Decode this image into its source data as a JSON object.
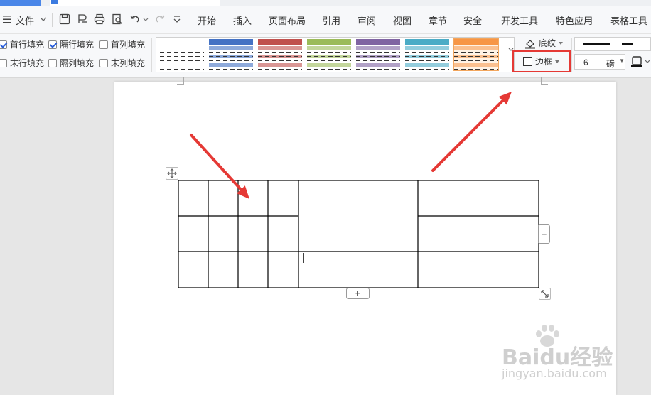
{
  "menubar": {
    "file": "文件",
    "tabs": [
      "开始",
      "插入",
      "页面布局",
      "引用",
      "审阅",
      "视图",
      "章节",
      "安全",
      "开发工具",
      "特色应用",
      "表格工具"
    ]
  },
  "ribbon": {
    "options": [
      {
        "label": "首行填充",
        "checked": true
      },
      {
        "label": "隔行填充",
        "checked": true
      },
      {
        "label": "首列填充",
        "checked": false
      },
      {
        "label": "末行填充",
        "checked": false
      },
      {
        "label": "隔列填充",
        "checked": false
      },
      {
        "label": "末列填充",
        "checked": false
      }
    ],
    "styles": [
      {
        "head": "#ffffff",
        "row": "#ffffff",
        "line": "#333333"
      },
      {
        "head": "#4472c4",
        "row": "#8eaadb",
        "line": "#ffffff"
      },
      {
        "head": "#c0504d",
        "row": "#d99694",
        "line": "#ffffff"
      },
      {
        "head": "#9bbb59",
        "row": "#c3d69b",
        "line": "#ffffff"
      },
      {
        "head": "#8064a2",
        "row": "#b2a2c7",
        "line": "#ffffff"
      },
      {
        "head": "#4bacc6",
        "row": "#93cddd",
        "line": "#ffffff"
      },
      {
        "head": "#f79646",
        "row": "#fac090",
        "line": "#ffffff"
      }
    ],
    "shading": "底纹",
    "border": "边框",
    "line_width_value": "6",
    "line_width_unit": "磅"
  },
  "annotation_color": "#e53935",
  "watermark": {
    "brand": "Baidu经验",
    "url": "jingyan.baidu.com"
  }
}
